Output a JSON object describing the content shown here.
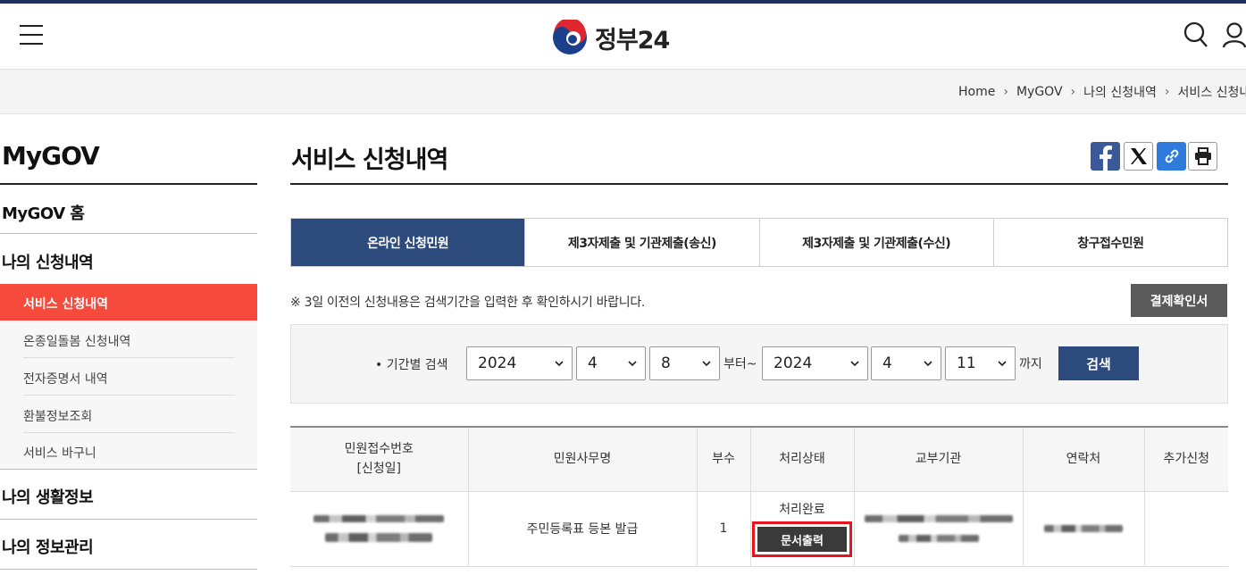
{
  "header": {
    "logo_text": "정부24",
    "menu_icon": "hamburger-icon",
    "search_icon": "search-icon",
    "user_icon": "user-icon"
  },
  "breadcrumb": [
    "Home",
    "MyGOV",
    "나의 신청내역",
    "서비스 신청내"
  ],
  "sidebar": {
    "title": "MyGOV",
    "main_items": [
      "MyGOV 홈",
      "나의 신청내역",
      "나의 생활정보",
      "나의 정보관리"
    ],
    "sub_items": [
      "서비스 신청내역",
      "온종일돌봄 신청내역",
      "전자증명서 내역",
      "환불정보조회",
      "서비스 바구니"
    ],
    "active_sub": "서비스 신청내역"
  },
  "page": {
    "title": "서비스 신청내역"
  },
  "share_icons": [
    "facebook-icon",
    "x-icon",
    "link-icon",
    "print-icon"
  ],
  "colors": {
    "primary_navy": "#2d4a7c",
    "active_red": "#f64a3c",
    "highlight_red": "#e8141b",
    "facebook_blue": "#3b5998"
  },
  "tabs": [
    "온라인 신청민원",
    "제3자제출 및 기관제출(송신)",
    "제3자제출 및 기관제출(수신)",
    "창구접수민원"
  ],
  "active_tab": "온라인 신청민원",
  "notice": "※ 3일 이전의 신청내용은 검색기간을 입력한 후 확인하시기 바랍니다.",
  "receipt_button": "결제확인서",
  "search": {
    "label": "• 기간별 검색",
    "from": {
      "year": "2024",
      "month": "4",
      "day": "8"
    },
    "from_word": "부터~",
    "to": {
      "year": "2024",
      "month": "4",
      "day": "11"
    },
    "to_word": "까지",
    "button": "검색"
  },
  "table": {
    "headers": [
      "민원접수번호",
      "[신청일]",
      "민원사무명",
      "부수",
      "처리상태",
      "교부기관",
      "연락처",
      "추가신청"
    ],
    "rows": [
      {
        "service_name": "주민등록표 등본 발급",
        "copies": "1",
        "status": "처리완료",
        "action": "문서출력"
      }
    ]
  }
}
